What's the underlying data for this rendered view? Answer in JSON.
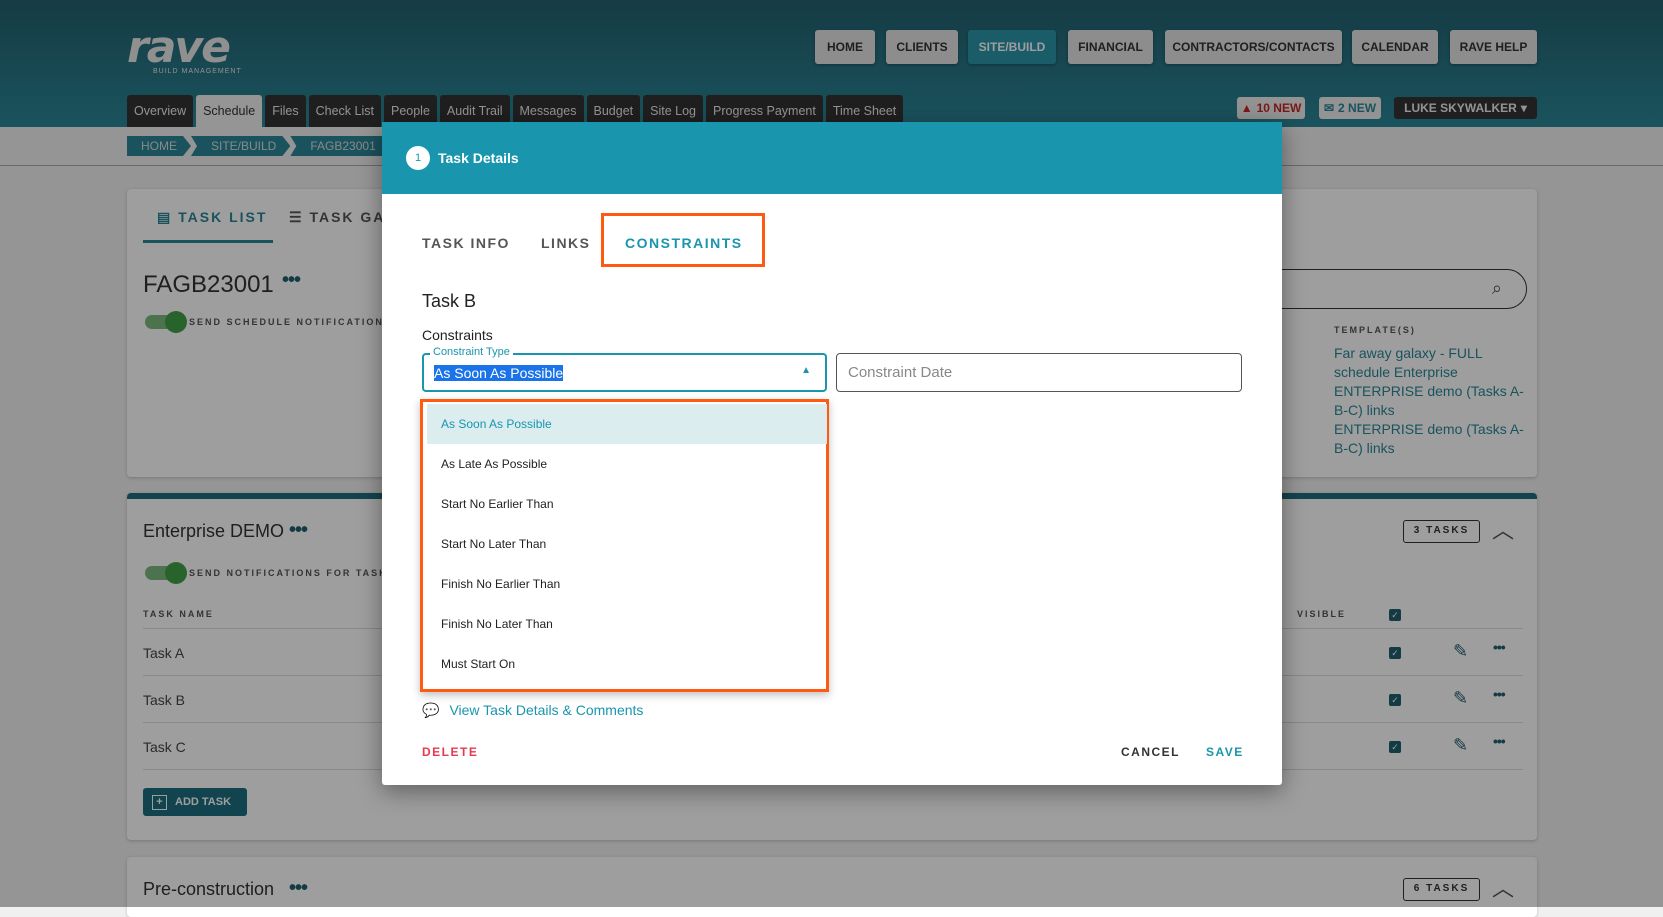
{
  "app": {
    "logo_text": "rave",
    "logo_sub": "BUILD MANAGEMENT"
  },
  "nav": [
    "HOME",
    "CLIENTS",
    "SITE/BUILD",
    "FINANCIAL",
    "CONTRACTORS/CONTACTS",
    "CALENDAR",
    "RAVE HELP"
  ],
  "tabs": [
    "Overview",
    "Schedule",
    "Files",
    "Check List",
    "People",
    "Audit Trail",
    "Messages",
    "Budget",
    "Site Log",
    "Progress Payment",
    "Time Sheet"
  ],
  "alerts": {
    "warnings": "10 NEW",
    "messages": "2 NEW",
    "user": "LUKE SKYWALKER"
  },
  "breadcrumb": [
    "HOME",
    "SITE/BUILD",
    "FAGB23001"
  ],
  "card1": {
    "tab_list": "TASK LIST",
    "tab_gantt": "TASK GA",
    "title": "FAGB23001",
    "toggle_label": "SEND SCHEDULE NOTIFICATIONS",
    "templates_label": "TEMPLATE(S)",
    "templates": [
      "Far away galaxy - FULL schedule Enterprise",
      "ENTERPRISE demo (Tasks A-B-C) links",
      "ENTERPRISE demo (Tasks A-B-C) links"
    ]
  },
  "card2": {
    "title": "Enterprise DEMO",
    "toggle_label": "SEND NOTIFICATIONS FOR TASK",
    "count": "3 TASKS",
    "col_name": "TASK NAME",
    "col_visible": "VISIBLE",
    "tasks": [
      "Task A",
      "Task B",
      "Task C"
    ],
    "add_task": "ADD TASK"
  },
  "card3": {
    "title": "Pre-construction",
    "count": "6 TASKS"
  },
  "modal": {
    "step": "1",
    "title": "Task Details",
    "tabs": [
      "TASK INFO",
      "LINKS",
      "CONSTRAINTS"
    ],
    "task_name": "Task B",
    "section": "Constraints",
    "type_label": "Constraint Type",
    "type_value": "As Soon As Possible",
    "date_placeholder": "Constraint Date",
    "options": [
      "As Soon As Possible",
      "As Late As Possible",
      "Start No Earlier Than",
      "Start No Later Than",
      "Finish No Earlier Than",
      "Finish No Later Than",
      "Must Start On"
    ],
    "comments_link": "View Task Details & Comments",
    "delete": "DELETE",
    "cancel": "CANCEL",
    "save": "SAVE"
  },
  "colors": {
    "accent": "#1996ad",
    "highlight": "#ff5a12",
    "danger": "#e53950"
  }
}
